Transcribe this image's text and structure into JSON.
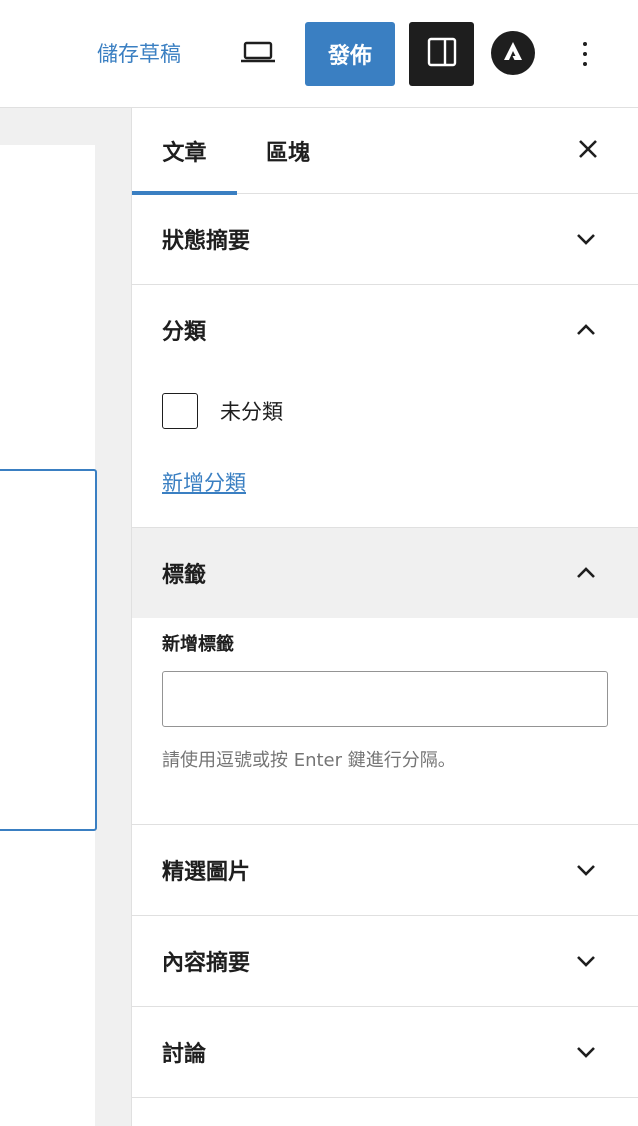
{
  "toolbar": {
    "save_draft_label": "儲存草稿",
    "preview_icon": "laptop-icon",
    "publish_label": "發佈",
    "settings_icon": "sidebar-toggle-icon",
    "astra_icon": "astra-logo-icon",
    "more_icon": "more-vertical-icon"
  },
  "sidebar": {
    "tabs": [
      {
        "label": "文章",
        "active": true
      },
      {
        "label": "區塊",
        "active": false
      }
    ],
    "close_icon": "close-icon",
    "panels": {
      "status": {
        "title": "狀態摘要",
        "expanded": false
      },
      "categories": {
        "title": "分類",
        "expanded": true,
        "items": [
          {
            "label": "未分類",
            "checked": false
          }
        ],
        "add_link": "新增分類"
      },
      "tags": {
        "title": "標籤",
        "expanded": true,
        "input_label": "新增標籤",
        "input_value": "",
        "help_text": "請使用逗號或按 Enter 鍵進行分隔。"
      },
      "featured_image": {
        "title": "精選圖片",
        "expanded": false
      },
      "excerpt": {
        "title": "內容摘要",
        "expanded": false
      },
      "discussion": {
        "title": "討論",
        "expanded": false
      }
    }
  },
  "colors": {
    "accent": "#3a7fc2",
    "dark": "#1e1e1e",
    "border": "#e0e0e0",
    "muted": "#757575"
  }
}
